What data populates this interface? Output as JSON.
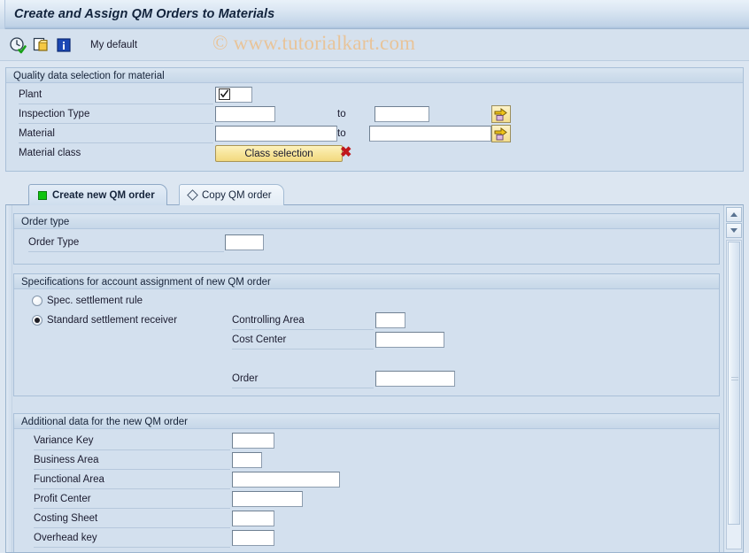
{
  "window": {
    "title": "Create and Assign QM Orders to Materials"
  },
  "watermark": {
    "text": "© www.tutorialkart.com"
  },
  "toolbar": {
    "icons": [
      {
        "name": "execute-clock-icon",
        "glyph": "execute"
      },
      {
        "name": "copy-variant-icon",
        "glyph": "copy"
      },
      {
        "name": "info-icon",
        "glyph": "info"
      }
    ],
    "my_default_label": "My default"
  },
  "selection_panel": {
    "title": "Quality data selection for material",
    "to_label": "to",
    "fields": [
      {
        "label": "Plant",
        "value": "",
        "has_multiselect_glyph": true
      },
      {
        "label": "Inspection Type",
        "value": "",
        "to_value": ""
      },
      {
        "label": "Material",
        "value": "",
        "to_value": ""
      },
      {
        "label": "Material class"
      }
    ],
    "class_selection_button": "Class selection",
    "delete_icon": "✖",
    "multi_select_arrow_icon": "⇨"
  },
  "tabs": [
    {
      "label": "Create new QM order",
      "icon": "green-square-icon",
      "active": true
    },
    {
      "label": "Copy QM order",
      "icon": "diamond-icon",
      "active": false
    }
  ],
  "order_type_group": {
    "title": "Order type",
    "field_label": "Order Type",
    "field_value": ""
  },
  "specifications_group": {
    "title": "Specifications for account assignment of new QM order",
    "radios": [
      {
        "label": "Spec. settlement rule",
        "selected": false
      },
      {
        "label": "Standard settlement receiver",
        "selected": true
      }
    ],
    "fields": [
      {
        "label": "Controlling Area",
        "value": ""
      },
      {
        "label": "Cost Center",
        "value": ""
      },
      {
        "label": "Order",
        "value": ""
      }
    ]
  },
  "additional_group": {
    "title": "Additional data for the new QM order",
    "fields": [
      {
        "label": "Variance Key",
        "value": ""
      },
      {
        "label": "Business Area",
        "value": ""
      },
      {
        "label": "Functional Area",
        "value": ""
      },
      {
        "label": "Profit Center",
        "value": ""
      },
      {
        "label": "Costing Sheet",
        "value": ""
      },
      {
        "label": "Overhead key",
        "value": ""
      }
    ]
  },
  "colors": {
    "title_bar": "#bfd2e6",
    "panel_background": "#d3e0ee",
    "page_background": "#dce6f1",
    "accent_button": "#f3dd8c",
    "active_tab_icon": "#0fc40f",
    "delete_icon": "#c0181c",
    "watermark": "#e8c49a"
  }
}
